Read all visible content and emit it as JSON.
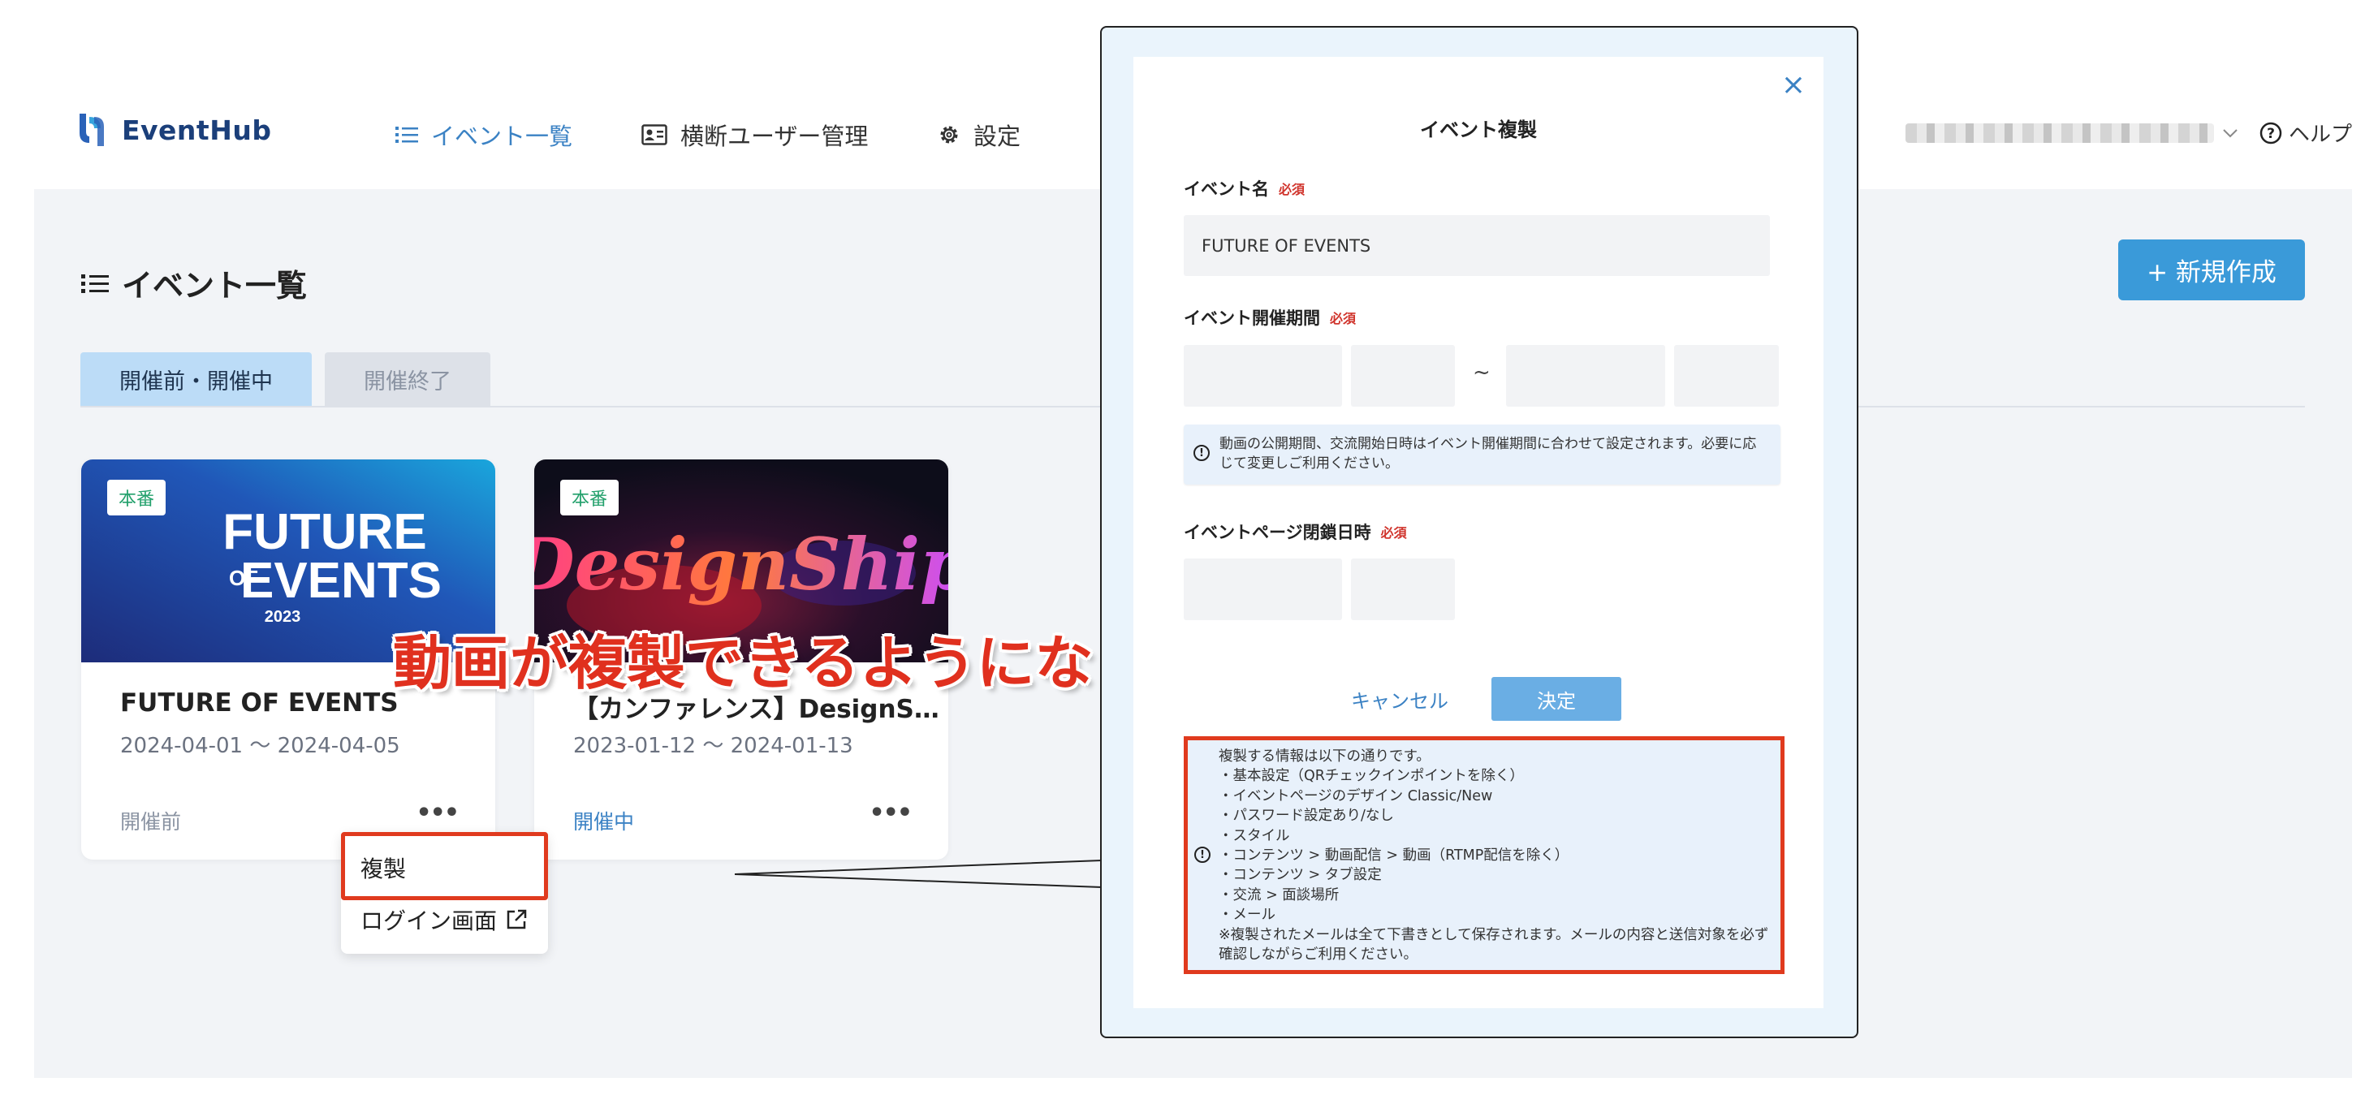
{
  "header": {
    "brand": "EventHub",
    "nav": [
      {
        "label": "イベント一覧",
        "icon": "list-icon",
        "active": true
      },
      {
        "label": "横断ユーザー管理",
        "icon": "id-card-icon",
        "active": false
      },
      {
        "label": "設定",
        "icon": "gear-icon",
        "active": false
      }
    ],
    "help_label": "ヘルプ"
  },
  "page": {
    "title": "イベント一覧",
    "new_button": "+ 新規作成",
    "tabs": [
      {
        "label": "開催前・開催中",
        "active": true
      },
      {
        "label": "開催終了",
        "active": false
      }
    ]
  },
  "cards": [
    {
      "badge": "本番",
      "banner_text": [
        "FUTURE",
        "OF",
        "EVENTS",
        "2023"
      ],
      "title": "FUTURE OF EVENTS",
      "dates": "2024-04-01 〜 2024-04-05",
      "status": "開催前",
      "status_color": "#8b94a3",
      "more": "•••"
    },
    {
      "badge": "本番",
      "banner_text": [
        "DesignShip"
      ],
      "title": "【カンファレンス】DesignS…",
      "dates": "2023-01-12 〜 2024-01-13",
      "status": "開催中",
      "status_color": "#3b82c4",
      "more": "•••"
    }
  ],
  "context_menu": {
    "items": [
      "複製",
      "ログイン画面"
    ]
  },
  "headline": "動画が複製できるようになりました！",
  "modal": {
    "close": "×",
    "title": "イベント複製",
    "required": "必須",
    "fields": {
      "name_label": "イベント名",
      "name_value": "FUTURE OF EVENTS",
      "period_label": "イベント開催期間",
      "period_separator": "~",
      "period_info": "動画の公開期間、交流開始日時はイベント開催期間に合わせて設定されます。必要に応じて変更しご利用ください。",
      "close_label": "イベントページ閉鎖日時"
    },
    "cancel": "キャンセル",
    "ok": "決定",
    "note_lines": [
      "複製する情報は以下の通りです。",
      "・基本設定（QRチェックインポイントを除く）",
      "・イベントページのデザイン Classic/New",
      "・パスワード設定あり/なし",
      "・スタイル",
      "・コンテンツ > 動画配信 > 動画（RTMP配信を除く）",
      "・コンテンツ > タブ設定",
      "・交流 > 面談場所",
      "・メール",
      "※複製されたメールは全て下書きとして保存されます。メールの内容と送信対象を必ず",
      "確認しながらご利用ください。"
    ]
  },
  "colors": {
    "accent": "#3b82c4",
    "primary_button": "#3a9ad9",
    "highlight_red": "#e03a1e",
    "production_badge": "#22a06b"
  }
}
